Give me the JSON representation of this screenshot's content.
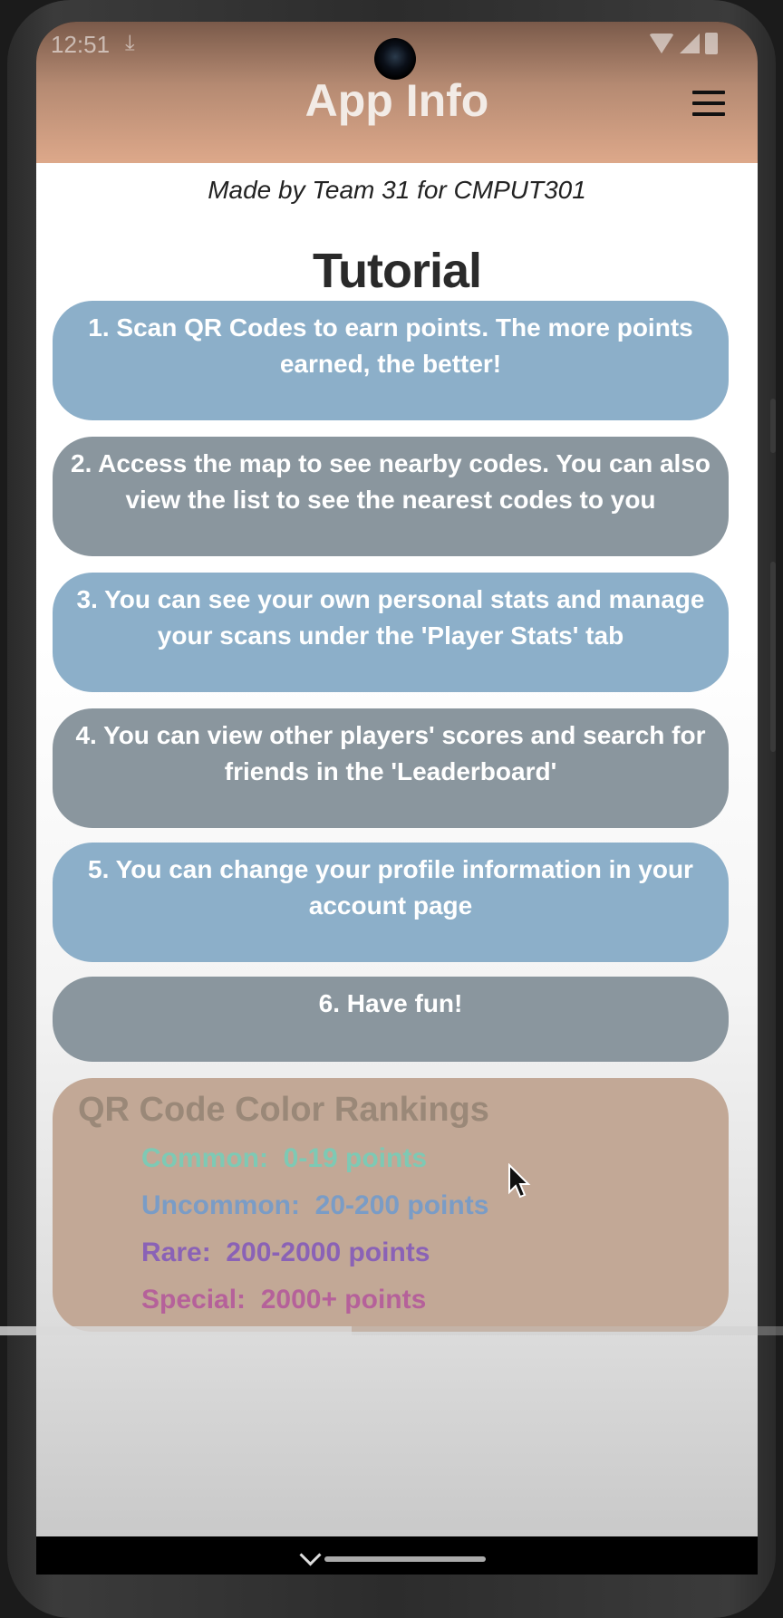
{
  "status_bar": {
    "time": "12:51",
    "download_icon": "download-icon"
  },
  "app_bar": {
    "title": "App Info",
    "menu_icon": "hamburger-menu-icon"
  },
  "content": {
    "made_by": "Made by Team 31 for CMPUT301",
    "tutorial_title": "Tutorial",
    "steps": [
      {
        "text": "1. Scan QR Codes to earn points. The more points earned, the better!"
      },
      {
        "text": "2. Access the map to see nearby codes. You can also view the list to see the nearest codes to you"
      },
      {
        "text": "3. You can see your own personal stats and manage your scans under the 'Player Stats' tab"
      },
      {
        "text": "4. You can view other players' scores and search for friends in the 'Leaderboard'"
      },
      {
        "text": "5. You can change your profile information in your account page"
      },
      {
        "text": "6. Have fun!"
      }
    ],
    "rankings": {
      "title": "QR Code Color Rankings",
      "items": [
        {
          "text": "Common:  0-19 points",
          "color": "#7ec9b4"
        },
        {
          "text": "Uncommon:  20-200 points",
          "color": "#7a9cc6"
        },
        {
          "text": "Rare:  200-2000 points",
          "color": "#8a62b6"
        },
        {
          "text": "Special:  2000+ points",
          "color": "#b5619a"
        }
      ]
    }
  },
  "colors": {
    "app_bar": "#dda88a",
    "card_blue": "#8cafc9",
    "card_grey": "#8a969e",
    "rank_box": "#c2a896"
  }
}
